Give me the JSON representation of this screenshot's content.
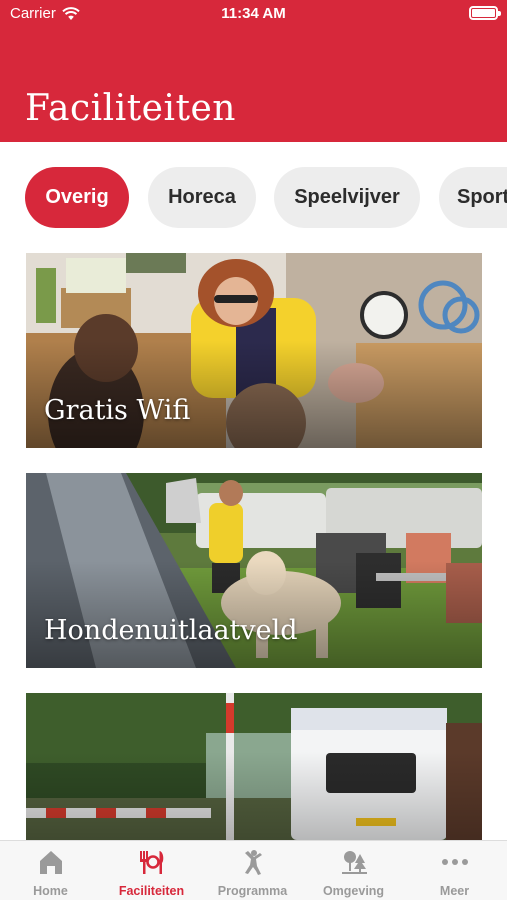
{
  "status_bar": {
    "carrier": "Carrier",
    "time": "11:34 AM"
  },
  "header": {
    "title": "Faciliteiten"
  },
  "categories": [
    {
      "label": "Overig",
      "active": true
    },
    {
      "label": "Horeca",
      "active": false
    },
    {
      "label": "Speelvijver",
      "active": false
    },
    {
      "label": "Sport",
      "active": false
    }
  ],
  "cards": [
    {
      "title": "Gratis Wifi"
    },
    {
      "title": "Hondenuitlaatveld"
    },
    {
      "title": ""
    }
  ],
  "tab_bar": {
    "items": [
      {
        "label": "Home",
        "icon": "home-icon"
      },
      {
        "label": "Faciliteiten",
        "icon": "dining-icon",
        "active": true
      },
      {
        "label": "Programma",
        "icon": "person-icon"
      },
      {
        "label": "Omgeving",
        "icon": "trees-icon"
      },
      {
        "label": "Meer",
        "icon": "more-icon"
      }
    ]
  },
  "colors": {
    "brand_red": "#d7283b",
    "chip_inactive": "#ededed",
    "tab_inactive": "#9a9a9a"
  }
}
